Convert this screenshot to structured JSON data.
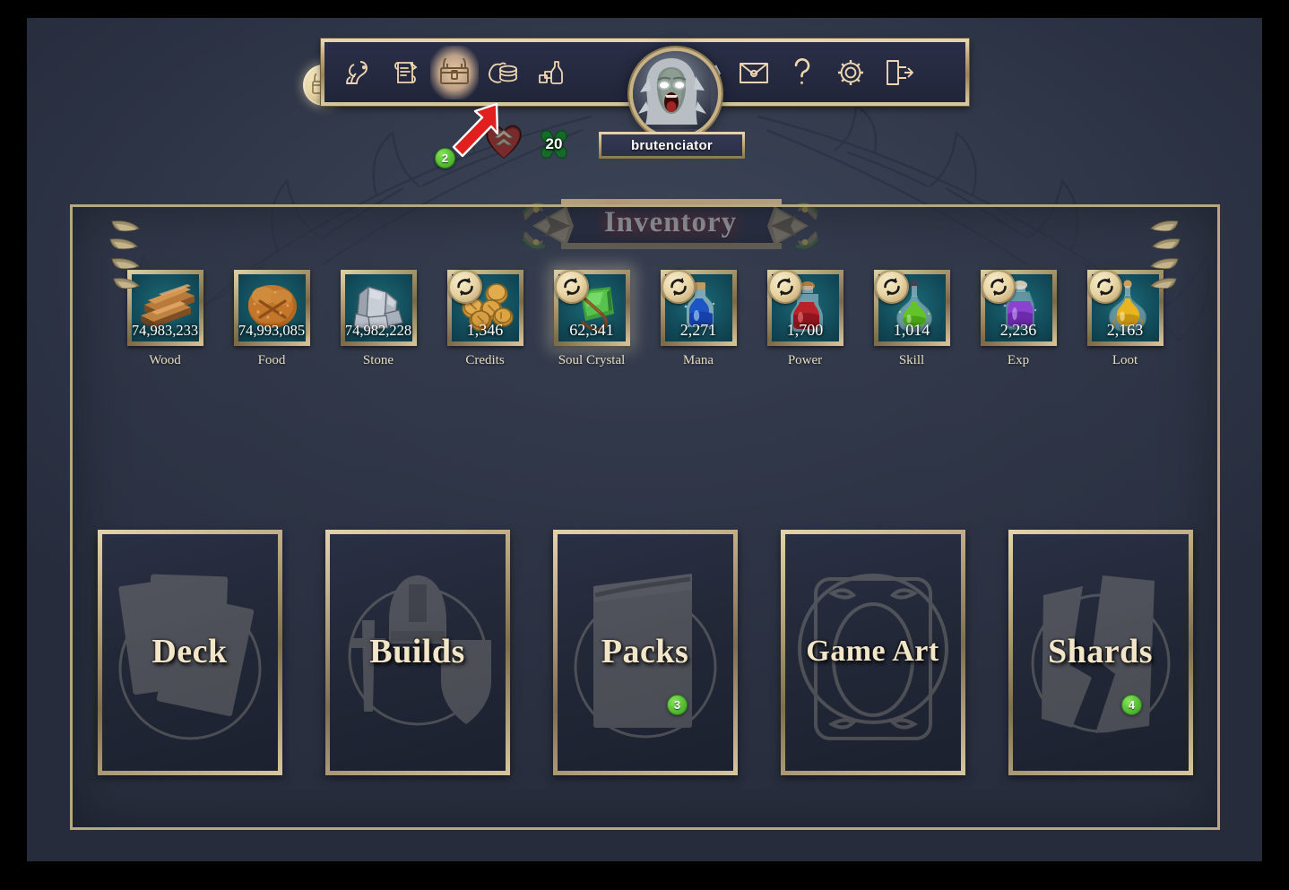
{
  "window": {
    "title": "Inventory"
  },
  "toolbar": {
    "chest_coin_icon": "treasure-chest-coin-icon",
    "buttons": [
      {
        "name": "creature",
        "icon": "creature-icon",
        "active": false
      },
      {
        "name": "quests",
        "icon": "scroll-quill-icon",
        "active": false
      },
      {
        "name": "inventory",
        "icon": "treasure-chest-icon",
        "active": true
      },
      {
        "name": "shop",
        "icon": "coin-pouch-icon",
        "active": false
      },
      {
        "name": "crafting",
        "icon": "potion-bottle-icon",
        "active": false
      },
      {
        "name": "market",
        "icon": "scales-icon",
        "active": false
      },
      {
        "name": "mail",
        "icon": "envelope-icon",
        "active": false
      },
      {
        "name": "help",
        "icon": "question-mark-icon",
        "active": false
      },
      {
        "name": "settings",
        "icon": "gear-icon",
        "active": false
      },
      {
        "name": "logout",
        "icon": "exit-door-icon",
        "active": false
      }
    ]
  },
  "player": {
    "avatar_icon": "banshee-portrait-avatar",
    "username": "brutenciator",
    "heart_icon": "heart-crest-icon",
    "clover_icon": "clover-icon",
    "clover_count": "20"
  },
  "annotations": {
    "arrow_icon": "red-pointer-arrow",
    "badges": [
      {
        "id": "badge2",
        "label": "2"
      },
      {
        "id": "badge3",
        "label": "3"
      },
      {
        "id": "badge4",
        "label": "4"
      }
    ]
  },
  "resources": [
    {
      "name": "Wood",
      "amount": "74,983,233",
      "icon": "wood-planks-icon",
      "recycle": false,
      "glow": false
    },
    {
      "name": "Food",
      "amount": "74,993,085",
      "icon": "bread-loaf-icon",
      "recycle": false,
      "glow": false
    },
    {
      "name": "Stone",
      "amount": "74,982,228",
      "icon": "stone-rocks-icon",
      "recycle": false,
      "glow": false
    },
    {
      "name": "Credits",
      "amount": "1,346",
      "icon": "gold-coins-icon",
      "recycle": true,
      "glow": false
    },
    {
      "name": "Soul Crystal",
      "amount": "62,341",
      "icon": "green-crystal-icon",
      "recycle": true,
      "glow": true
    },
    {
      "name": "Mana",
      "amount": "2,271",
      "icon": "blue-potion-icon",
      "recycle": true,
      "glow": false
    },
    {
      "name": "Power",
      "amount": "1,700",
      "icon": "red-potion-icon",
      "recycle": true,
      "glow": false
    },
    {
      "name": "Skill",
      "amount": "1,014",
      "icon": "green-potion-icon",
      "recycle": true,
      "glow": false
    },
    {
      "name": "Exp",
      "amount": "2,236",
      "icon": "purple-potion-icon",
      "recycle": true,
      "glow": false
    },
    {
      "name": "Loot",
      "amount": "2,163",
      "icon": "yellow-potion-icon",
      "recycle": true,
      "glow": false
    }
  ],
  "categories": [
    {
      "label": "Deck",
      "icon": "cards-stack-icon"
    },
    {
      "label": "Builds",
      "icon": "helmet-sword-shield-icon"
    },
    {
      "label": "Packs",
      "icon": "card-pack-icon",
      "badge": "3"
    },
    {
      "label": "Game Art",
      "icon": "framed-card-icon"
    },
    {
      "label": "Shards",
      "icon": "broken-card-icon",
      "badge": "4"
    }
  ],
  "colors": {
    "gold": "#d6c49a",
    "panel_bg": "#2e3547",
    "slot_teal": "#14505e",
    "badge_green": "#5dc43a",
    "arrow_red": "#e02020",
    "title_glow": "#b03a3a"
  }
}
